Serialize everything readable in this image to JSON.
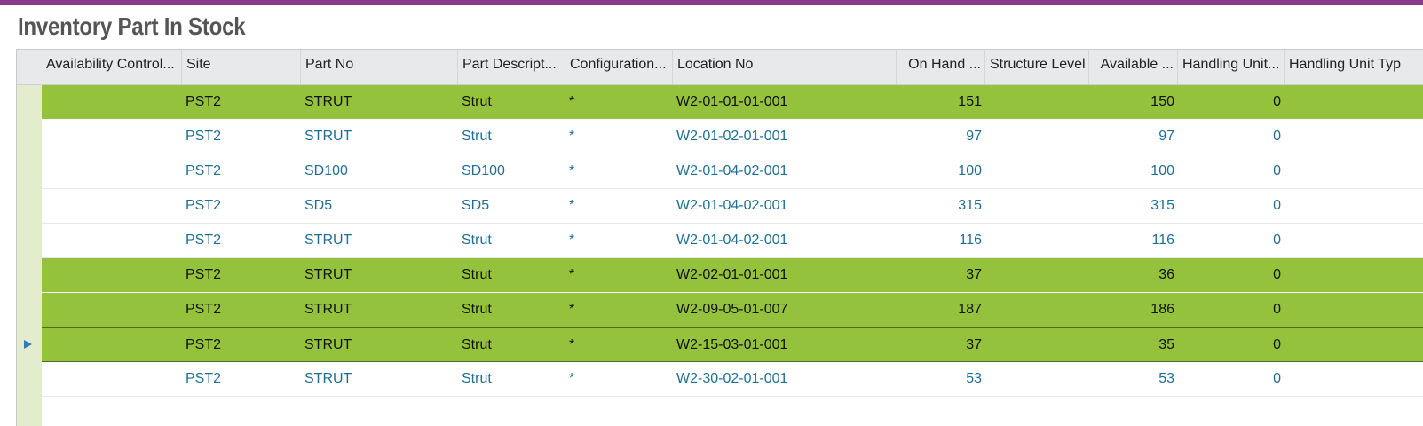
{
  "page": {
    "title": "Inventory Part In Stock",
    "accent_color": "#8a3a8d",
    "highlight_color": "#95c23d",
    "link_color": "#1f6e94"
  },
  "columns": [
    {
      "key": "availability_control",
      "label": "Availability Control..."
    },
    {
      "key": "site",
      "label": "Site"
    },
    {
      "key": "part_no",
      "label": "Part No"
    },
    {
      "key": "part_description",
      "label": "Part Descript..."
    },
    {
      "key": "configuration",
      "label": "Configuration..."
    },
    {
      "key": "location_no",
      "label": "Location No"
    },
    {
      "key": "on_hand",
      "label": "On Hand ..."
    },
    {
      "key": "structure_level",
      "label": "Structure Level"
    },
    {
      "key": "available",
      "label": "Available ..."
    },
    {
      "key": "handling_unit",
      "label": "Handling Unit..."
    },
    {
      "key": "handling_unit_type",
      "label": "Handling Unit Typ"
    }
  ],
  "rows": [
    {
      "highlighted": true,
      "current": false,
      "availability_control": "",
      "site": "PST2",
      "part_no": "STRUT",
      "part_description": "Strut",
      "configuration": "*",
      "location_no": "W2-01-01-01-001",
      "on_hand": "151",
      "structure_level": "",
      "available": "150",
      "handling_unit": "0",
      "handling_unit_type": ""
    },
    {
      "highlighted": false,
      "current": false,
      "availability_control": "",
      "site": "PST2",
      "part_no": "STRUT",
      "part_description": "Strut",
      "configuration": "*",
      "location_no": "W2-01-02-01-001",
      "on_hand": "97",
      "structure_level": "",
      "available": "97",
      "handling_unit": "0",
      "handling_unit_type": ""
    },
    {
      "highlighted": false,
      "current": false,
      "availability_control": "",
      "site": "PST2",
      "part_no": "SD100",
      "part_description": "SD100",
      "configuration": "*",
      "location_no": "W2-01-04-02-001",
      "on_hand": "100",
      "structure_level": "",
      "available": "100",
      "handling_unit": "0",
      "handling_unit_type": ""
    },
    {
      "highlighted": false,
      "current": false,
      "availability_control": "",
      "site": "PST2",
      "part_no": "SD5",
      "part_description": "SD5",
      "configuration": "*",
      "location_no": "W2-01-04-02-001",
      "on_hand": "315",
      "structure_level": "",
      "available": "315",
      "handling_unit": "0",
      "handling_unit_type": ""
    },
    {
      "highlighted": false,
      "current": false,
      "availability_control": "",
      "site": "PST2",
      "part_no": "STRUT",
      "part_description": "Strut",
      "configuration": "*",
      "location_no": "W2-01-04-02-001",
      "on_hand": "116",
      "structure_level": "",
      "available": "116",
      "handling_unit": "0",
      "handling_unit_type": ""
    },
    {
      "highlighted": true,
      "current": false,
      "availability_control": "",
      "site": "PST2",
      "part_no": "STRUT",
      "part_description": "Strut",
      "configuration": "*",
      "location_no": "W2-02-01-01-001",
      "on_hand": "37",
      "structure_level": "",
      "available": "36",
      "handling_unit": "0",
      "handling_unit_type": ""
    },
    {
      "highlighted": true,
      "current": false,
      "availability_control": "",
      "site": "PST2",
      "part_no": "STRUT",
      "part_description": "Strut",
      "configuration": "*",
      "location_no": "W2-09-05-01-007",
      "on_hand": "187",
      "structure_level": "",
      "available": "186",
      "handling_unit": "0",
      "handling_unit_type": ""
    },
    {
      "highlighted": true,
      "current": true,
      "availability_control": "",
      "site": "PST2",
      "part_no": "STRUT",
      "part_description": "Strut",
      "configuration": "*",
      "location_no": "W2-15-03-01-001",
      "on_hand": "37",
      "structure_level": "",
      "available": "35",
      "handling_unit": "0",
      "handling_unit_type": ""
    },
    {
      "highlighted": false,
      "current": false,
      "availability_control": "",
      "site": "PST2",
      "part_no": "STRUT",
      "part_description": "Strut",
      "configuration": "*",
      "location_no": "W2-30-02-01-001",
      "on_hand": "53",
      "structure_level": "",
      "available": "53",
      "handling_unit": "0",
      "handling_unit_type": ""
    }
  ]
}
